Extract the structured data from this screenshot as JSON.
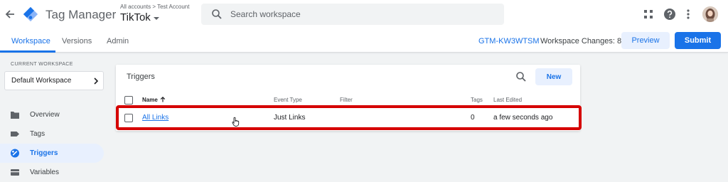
{
  "app": {
    "title": "Tag Manager",
    "breadcrumb": "All accounts > Test Account",
    "container": "TikTok"
  },
  "search": {
    "placeholder": "Search workspace"
  },
  "tabs": [
    {
      "label": "Workspace",
      "active": true
    },
    {
      "label": "Versions",
      "active": false
    },
    {
      "label": "Admin",
      "active": false
    }
  ],
  "header": {
    "container_id": "GTM-KW3WTSM",
    "workspace_changes": "Workspace Changes: 8",
    "preview_label": "Preview",
    "submit_label": "Submit"
  },
  "sidebar": {
    "current_workspace_label": "CURRENT WORKSPACE",
    "workspace_name": "Default Workspace",
    "items": [
      {
        "label": "Overview",
        "icon": "overview-icon",
        "active": false
      },
      {
        "label": "Tags",
        "icon": "tag-icon",
        "active": false
      },
      {
        "label": "Triggers",
        "icon": "trigger-icon",
        "active": true
      },
      {
        "label": "Variables",
        "icon": "variables-icon",
        "active": false
      }
    ]
  },
  "triggers": {
    "title": "Triggers",
    "new_label": "New",
    "columns": [
      "Name",
      "Event Type",
      "Filter",
      "Tags",
      "Last Edited"
    ],
    "rows": [
      {
        "name": "All Links",
        "event_type": "Just Links",
        "filter": "",
        "tags": "0",
        "last_edited": "a few seconds ago"
      }
    ]
  },
  "colors": {
    "accent": "#1a73e8",
    "highlight_border": "#d50000",
    "background": "#f1f3f4"
  }
}
